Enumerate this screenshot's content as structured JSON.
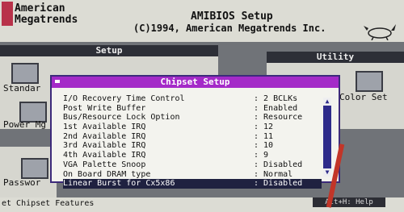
{
  "header": {
    "brand_line1": "American",
    "brand_line2": "Megatrends",
    "title": "AMIBIOS Setup",
    "copyright": "(C)1994, American Megatrends Inc."
  },
  "panels": {
    "setup_title": "Setup",
    "utility_title": "Utility",
    "setup_icons": [
      {
        "label": "Standar"
      },
      {
        "label": "Power Mg"
      }
    ],
    "utility_icons": [
      {
        "label": "Color Set"
      }
    ],
    "bottom_icon_label": "Passwor"
  },
  "dialog": {
    "title": "Chipset Setup",
    "items": [
      {
        "label": "I/O Recovery Time Control",
        "value": ": 2 BCLKs"
      },
      {
        "label": "Post Write Buffer",
        "value": ": Enabled"
      },
      {
        "label": "Bus/Resource Lock Option",
        "value": ": Resource"
      },
      {
        "label": "1st Available IRQ",
        "value": ": 12"
      },
      {
        "label": "2nd Available IRQ",
        "value": ": 11"
      },
      {
        "label": "3rd Available IRQ",
        "value": ": 10"
      },
      {
        "label": "4th Available IRQ",
        "value": ":  9"
      },
      {
        "label": "VGA Palette Snoop",
        "value": ": Disabled"
      },
      {
        "label": "On Board DRAM type",
        "value": ": Normal"
      },
      {
        "label": "Linear Burst for Cx5x86",
        "value": ": Disabled"
      }
    ],
    "selected_index": 9
  },
  "statusbar": {
    "text": "et Chipset Features",
    "help": "Alt+H: Help"
  },
  "colors": {
    "dialog_title_bg": "#a42ac8",
    "selection_bg": "#1f2140",
    "scrollbar": "#2d2a8a"
  }
}
